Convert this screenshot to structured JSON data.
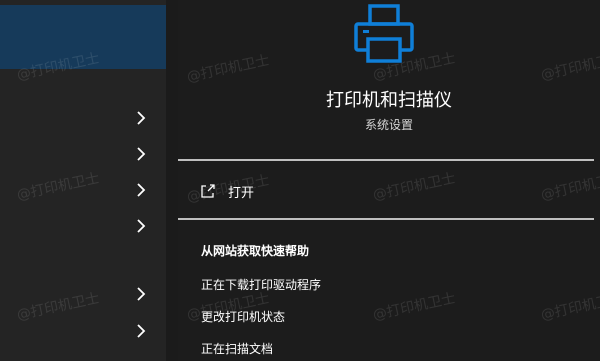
{
  "detail": {
    "title": "打印机和扫描仪",
    "subtitle": "系统设置",
    "open_label": "打开",
    "help_section_title": "从网站获取快速帮助",
    "help_links": [
      "正在下载打印驱动程序",
      "更改打印机状态",
      "正在扫描文档"
    ]
  },
  "watermark": {
    "text": "@打印机卫士"
  },
  "colors": {
    "accent": "#0078d4",
    "selected_row": "#163a5a",
    "background": "#1c1c1c"
  },
  "icons": {
    "app": "printer-icon",
    "open": "open-external-icon",
    "row": "chevron-right-icon"
  }
}
